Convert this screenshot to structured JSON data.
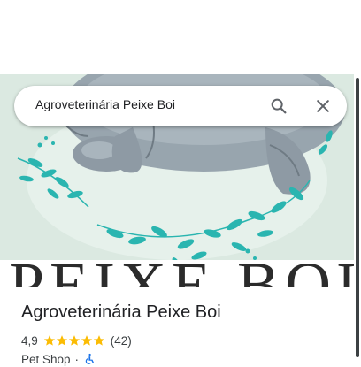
{
  "search": {
    "query": "Agroveterinária Peixe Boi"
  },
  "hero": {
    "logo_text": "PEIXE BOI",
    "logo_color": "#2b2b2b",
    "background_color": "#dbe9e1",
    "leaf_color": "#2ab5b0",
    "manatee_color": "#8e9aa4"
  },
  "place": {
    "name": "Agroveterinária Peixe Boi",
    "rating": "4,9",
    "stars": 5,
    "review_count": "(42)",
    "category": "Pet Shop",
    "separator": "·",
    "star_color": "#fbbc04",
    "accessibility_color": "#1a73e8"
  },
  "icons": {
    "search": "search-icon",
    "close": "close-icon",
    "star": "star-icon",
    "accessibility": "wheelchair-icon"
  }
}
